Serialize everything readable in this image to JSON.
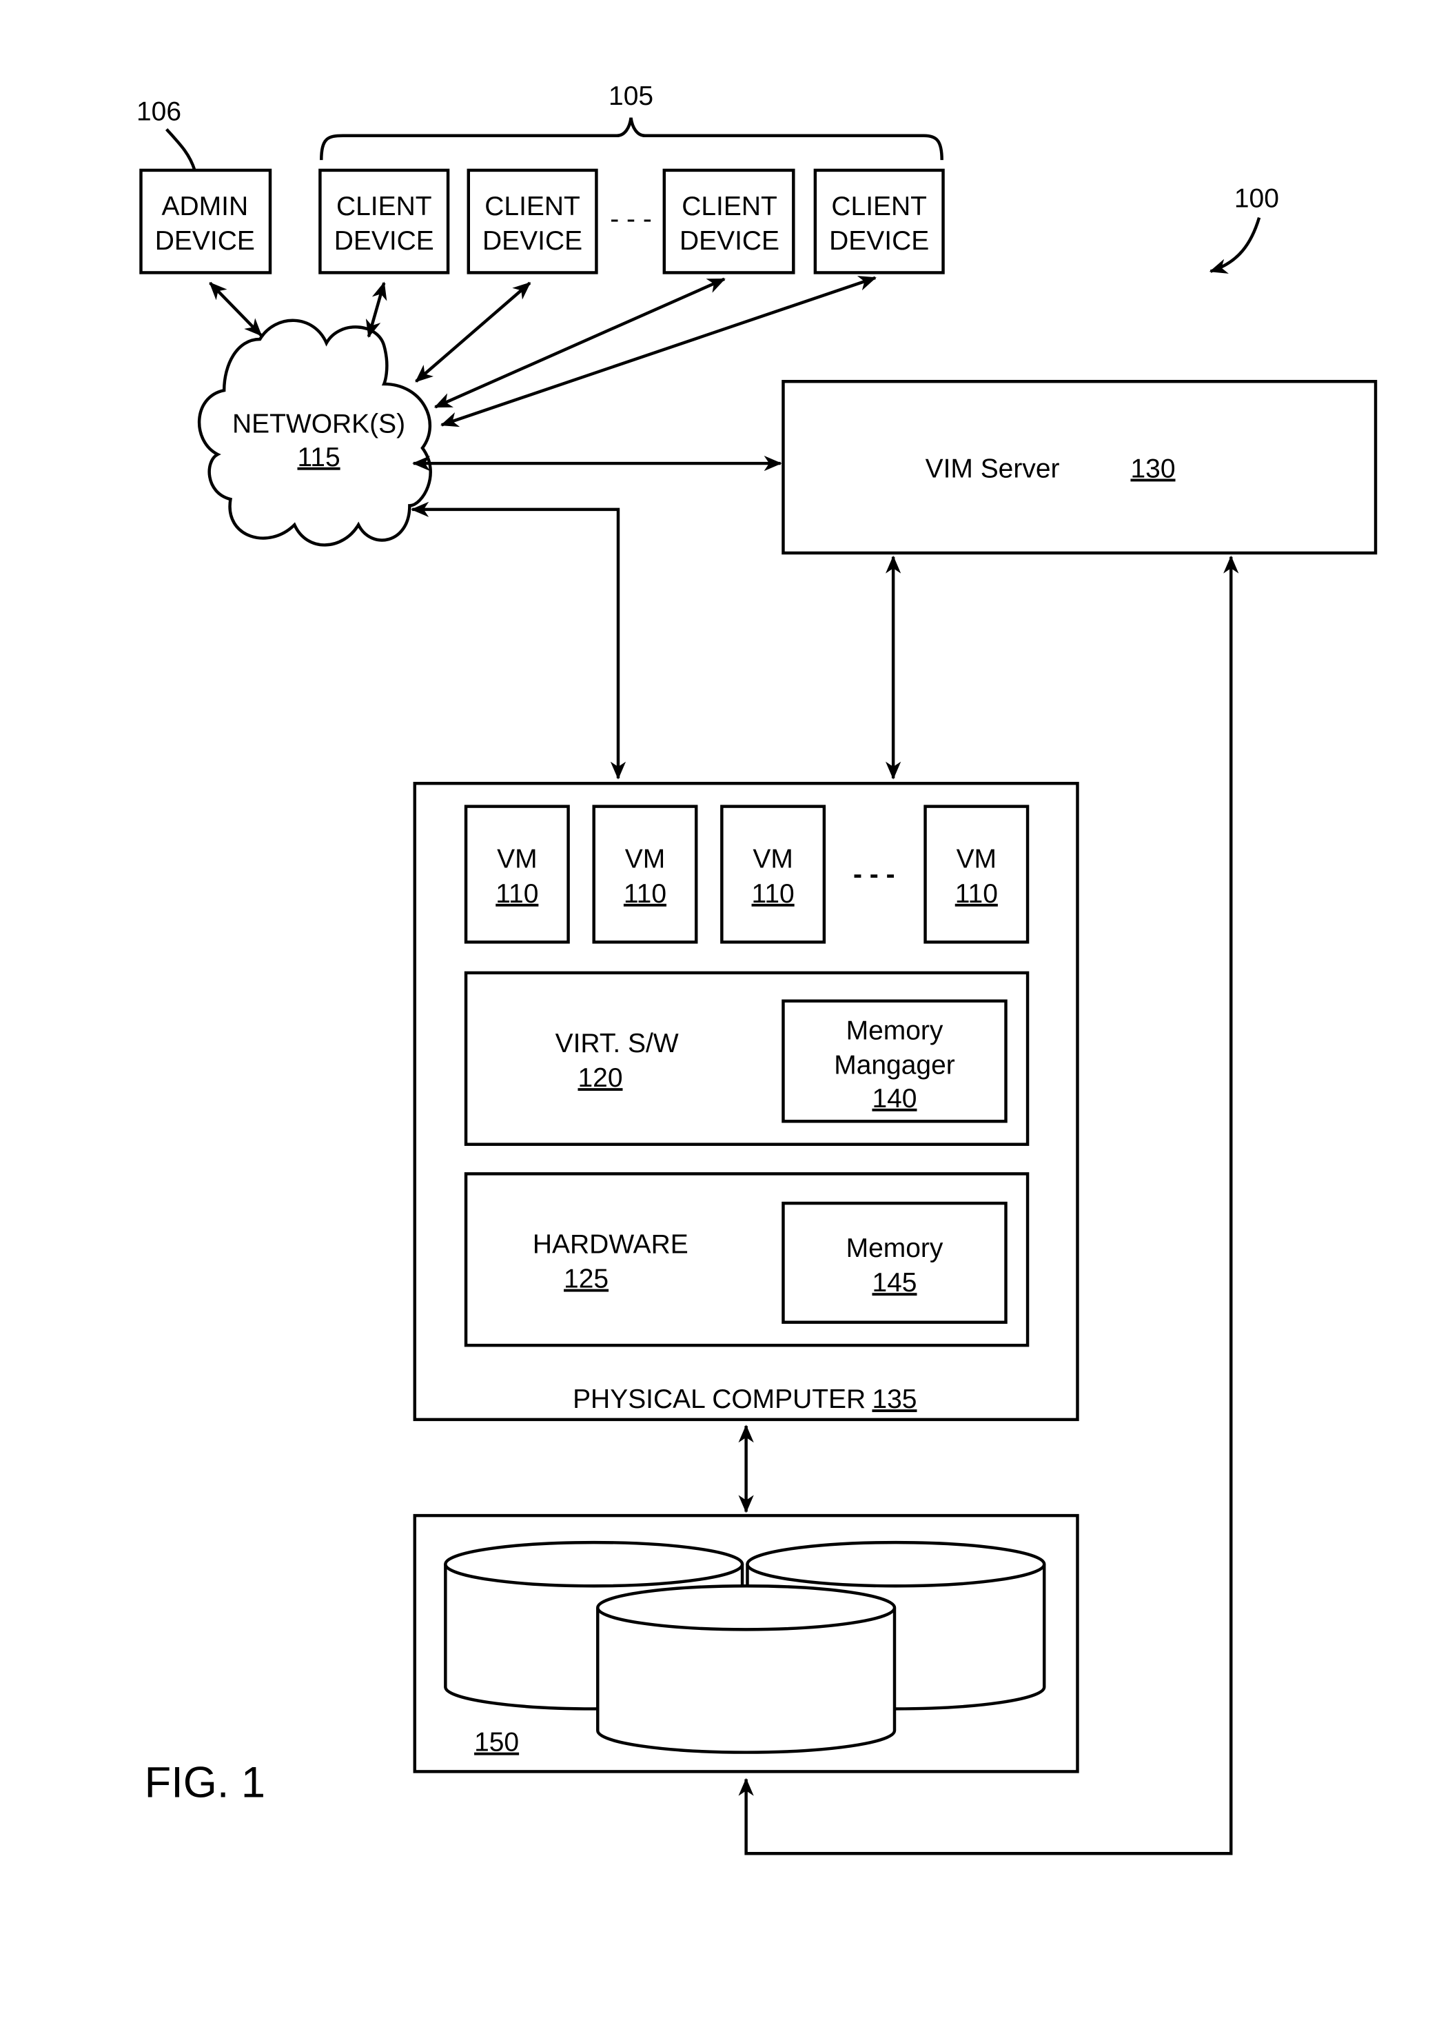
{
  "figure": {
    "label": "FIG. 1",
    "system_ref": "100"
  },
  "top": {
    "admin_ref": "106",
    "clients_ref": "105",
    "admin_device": [
      "ADMIN",
      "DEVICE"
    ],
    "client_devices": [
      [
        "CLIENT",
        "DEVICE"
      ],
      [
        "CLIENT",
        "DEVICE"
      ],
      [
        "CLIENT",
        "DEVICE"
      ],
      [
        "CLIENT",
        "DEVICE"
      ]
    ],
    "ellipsis": "- - -"
  },
  "network": {
    "label": "NETWORK(S)",
    "ref": "115"
  },
  "vim_server": {
    "label": "VIM Server",
    "ref": "130"
  },
  "physical_computer": {
    "label": "PHYSICAL COMPUTER",
    "ref": "135",
    "vms": [
      {
        "label": "VM",
        "ref": "110"
      },
      {
        "label": "VM",
        "ref": "110"
      },
      {
        "label": "VM",
        "ref": "110"
      },
      {
        "label": "VM",
        "ref": "110"
      }
    ],
    "vm_ellipsis": "- - -",
    "virt_sw": {
      "label": "VIRT. S/W",
      "ref": "120"
    },
    "memory_manager": {
      "line1": "Memory",
      "line2": "Mangager",
      "ref": "140"
    },
    "hardware": {
      "label": "HARDWARE",
      "ref": "125"
    },
    "memory": {
      "label": "Memory",
      "ref": "145"
    }
  },
  "storage": {
    "ref": "150"
  }
}
